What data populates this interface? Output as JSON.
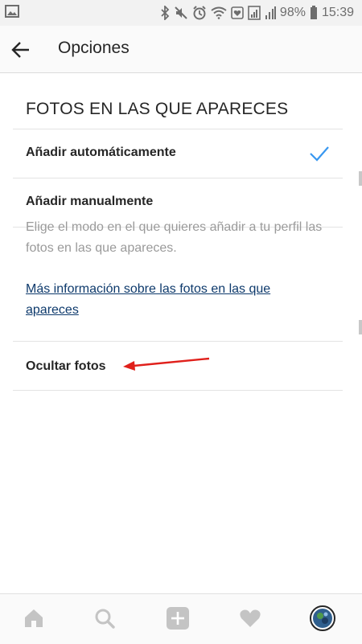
{
  "status_bar": {
    "battery": "98%",
    "time": "15:39",
    "icons": [
      "gallery-icon",
      "bluetooth-icon",
      "mute-icon",
      "alarm-icon",
      "wifi-icon",
      "data-icon",
      "signal-icon",
      "battery-icon"
    ]
  },
  "header": {
    "title": "Opciones",
    "back_icon": "back-arrow-icon"
  },
  "section": {
    "title": "FOTOS EN LAS QUE APARECES",
    "options": [
      {
        "label": "Añadir automáticamente",
        "selected": true
      },
      {
        "label": "Añadir manualmente",
        "selected": false
      }
    ],
    "help_text": "Elige el modo en el que quieres añadir a tu perfil las fotos en las que apareces.",
    "help_link": "Más información sobre las fotos en las que apareces",
    "hide_photos_label": "Ocultar fotos"
  },
  "bottom_nav": {
    "items": [
      "home-icon",
      "search-icon",
      "add-icon",
      "heart-icon",
      "profile-avatar"
    ]
  },
  "colors": {
    "accent": "#3897f0",
    "link": "#0e3a6c",
    "annotation_arrow": "#e0201b"
  }
}
